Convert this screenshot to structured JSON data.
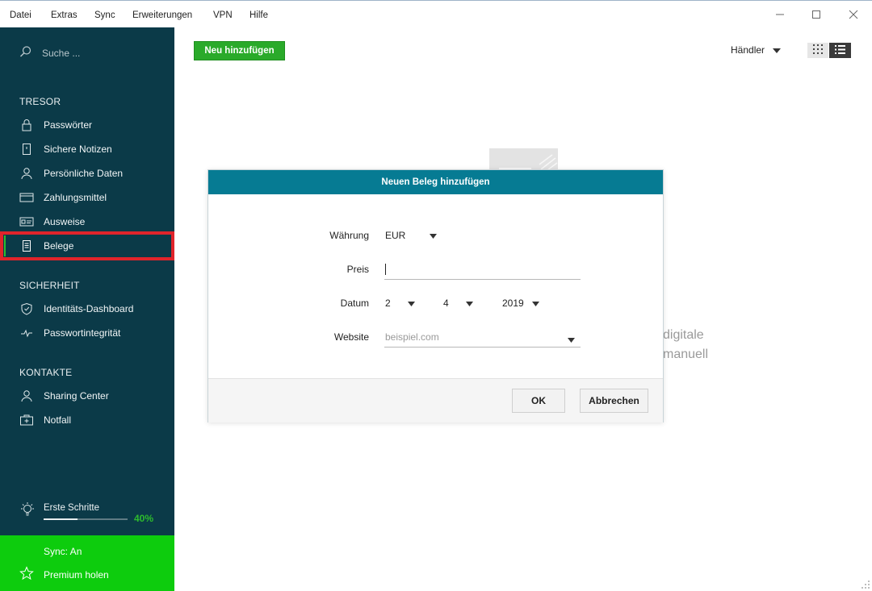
{
  "menubar": {
    "items": [
      "Datei",
      "Extras",
      "Sync",
      "Erweiterungen",
      "VPN",
      "Hilfe"
    ]
  },
  "sidebar": {
    "search_placeholder": "Suche ...",
    "sections": {
      "tresor": "TRESOR",
      "sicherheit": "SICHERHEIT",
      "kontakte": "KONTAKTE"
    },
    "tresor_items": [
      "Passwörter",
      "Sichere Notizen",
      "Persönliche Daten",
      "Zahlungsmittel",
      "Ausweise",
      "Belege"
    ],
    "sicherheit_items": [
      "Identitäts-Dashboard",
      "Passwortintegrität"
    ],
    "kontakte_items": [
      "Sharing Center",
      "Notfall"
    ],
    "steps_label": "Erste Schritte",
    "steps_percent_text": "40%",
    "steps_progress": 0.4,
    "sync_status": "Sync: An",
    "premium_label": "Premium holen",
    "colors": {
      "background": "#0b3a48",
      "active_outline": "#e0242b",
      "accent_green": "#0dcc0d"
    }
  },
  "main": {
    "add_button": "Neu hinzufügen",
    "sort_label": "Händler",
    "empty_text_line1": "digitale",
    "empty_text_line2": "manuell"
  },
  "modal": {
    "title": "Neuen Beleg hinzufügen",
    "currency_label": "Währung",
    "currency_value": "EUR",
    "price_label": "Preis",
    "price_value": "",
    "date_label": "Datum",
    "date_day": "2",
    "date_month": "4",
    "date_year": "2019",
    "website_label": "Website",
    "website_placeholder": "beispiel.com",
    "ok_button": "OK",
    "cancel_button": "Abbrechen",
    "header_color": "#067b93"
  }
}
